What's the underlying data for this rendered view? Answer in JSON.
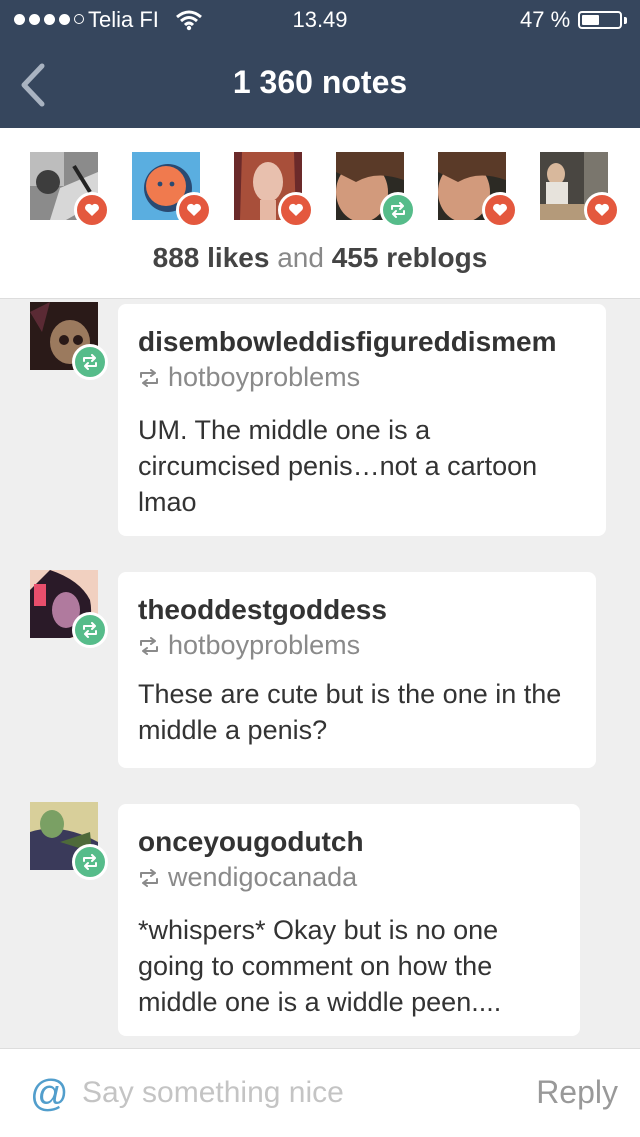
{
  "status_bar": {
    "carrier": "Telia FI",
    "time": "13.49",
    "battery": "47 %",
    "battery_level": 0.47
  },
  "header": {
    "title": "1 360 notes"
  },
  "engagement": {
    "avatars": [
      {
        "badge": "heart"
      },
      {
        "badge": "heart"
      },
      {
        "badge": "heart"
      },
      {
        "badge": "reblog"
      },
      {
        "badge": "heart"
      },
      {
        "badge": "heart"
      }
    ],
    "likes_count": "888 likes",
    "and_text": "and",
    "reblogs_count": "455 reblogs"
  },
  "notes": [
    {
      "username": "disembowleddisfigureddismem",
      "via": "hotboyproblems",
      "text": "UM. The middle one is a circumcised penis…not a cartoon lmao"
    },
    {
      "username": "theoddestgoddess",
      "via": "hotboyproblems",
      "text": "These are cute but is the one in the middle a penis?"
    },
    {
      "username": "onceyougodutch",
      "via": "wendigocanada",
      "text": "*whispers* Okay but is no one going to comment on how the middle one is a widdle peen...."
    }
  ],
  "composer": {
    "at_symbol": "@",
    "placeholder": "Say something nice",
    "reply_label": "Reply"
  },
  "colors": {
    "header_bg": "#36465d",
    "heart": "#e4583e",
    "reblog": "#56bc8a",
    "at": "#529ecc"
  }
}
